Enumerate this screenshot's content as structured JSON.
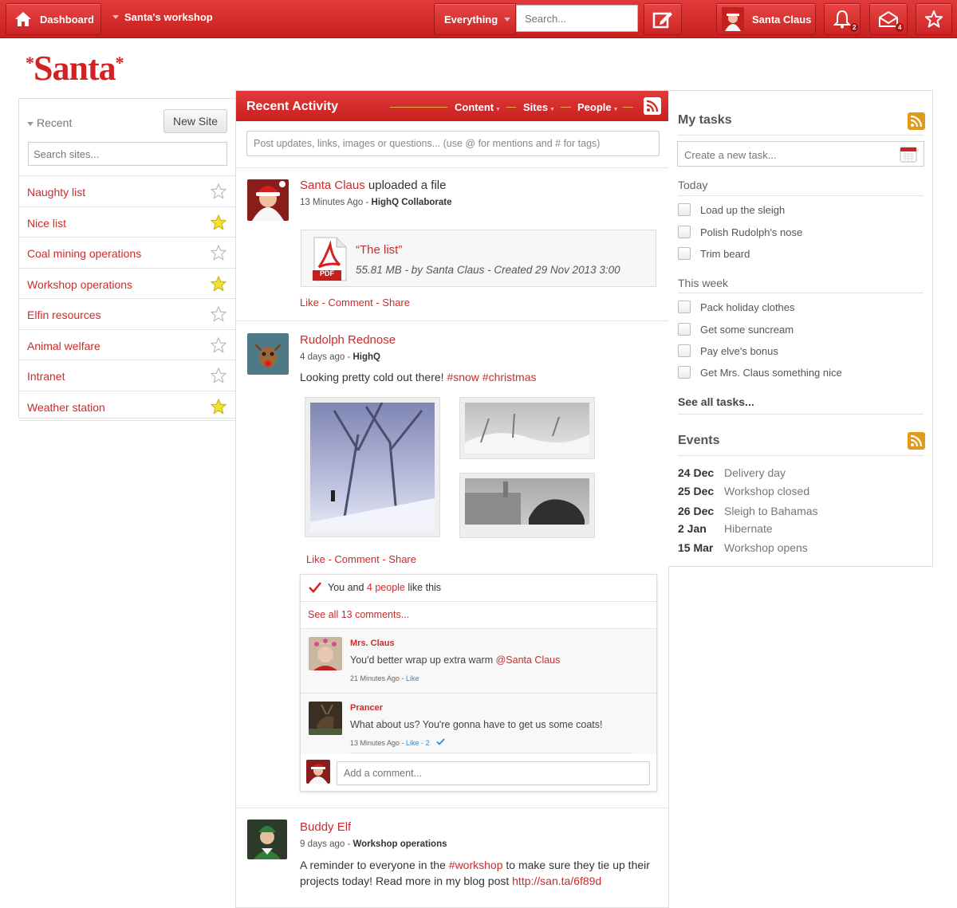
{
  "topbar": {
    "dashboard": "Dashboard",
    "workshop": "Santa's workshop",
    "scope": "Everything",
    "search_placeholder": "Search...",
    "user": "Santa Claus",
    "notifications_count": "2",
    "messages_count": "4"
  },
  "logo": {
    "text": "Santa",
    "mark": "*"
  },
  "sidebar": {
    "recent_label": "Recent",
    "new_site": "New Site",
    "search_placeholder": "Search sites...",
    "items": [
      {
        "label": "Naughty list",
        "starred": false
      },
      {
        "label": "Nice list",
        "starred": true
      },
      {
        "label": "Coal mining operations",
        "starred": false
      },
      {
        "label": "Workshop operations",
        "starred": true
      },
      {
        "label": "Elfin resources",
        "starred": false
      },
      {
        "label": "Animal welfare",
        "starred": false
      },
      {
        "label": "Intranet",
        "starred": false
      },
      {
        "label": "Weather station",
        "starred": true
      }
    ]
  },
  "activity": {
    "title": "Recent Activity",
    "filters": [
      "Content",
      "Sites",
      "People"
    ],
    "post_placeholder": "Post updates, links, images or questions... (use @ for mentions and # for tags)",
    "posts": [
      {
        "author": "Santa Claus",
        "verb": "uploaded a file",
        "time": "13 Minutes Ago",
        "site": "HighQ Collaborate",
        "file_title": "“The list”",
        "file_meta": "55.81 MB - by Santa Claus - Created 29 Nov 2013 3:00",
        "file_badge": "PDF",
        "actions": "Like - Comment - Share"
      },
      {
        "author": "Rudolph Rednose",
        "time": "4 days ago",
        "site": "HighQ",
        "text": "Looking pretty cold out there!",
        "tags": "#snow #christmas",
        "actions": "Like - Comment - Share",
        "likes_prefix": "You and",
        "likes_link": "4 people",
        "likes_suffix": "like this",
        "see_all": "See all 13 comments...",
        "comments": [
          {
            "author": "Mrs. Claus",
            "text": "You'd better wrap up extra warm",
            "mention": "@Santa Claus",
            "time": "21 Minutes Ago",
            "like": "Like"
          },
          {
            "author": "Prancer",
            "text": "What about us? You're gonna have to get us some coats!",
            "time": "13 Minutes Ago",
            "like": "Like - 2"
          }
        ],
        "comment_placeholder": "Add a comment..."
      },
      {
        "author": "Buddy Elf",
        "time": "9 days ago",
        "site": "Workshop operations",
        "text_a": "A reminder to everyone in the",
        "tag": "#workshop",
        "text_b": "to make sure they tie up their",
        "text_c": "projects today! Read more in my blog post",
        "link": "http://san.ta/6f89d"
      }
    ]
  },
  "tasks": {
    "title": "My tasks",
    "placeholder": "Create a new task...",
    "today_label": "Today",
    "today": [
      "Load up the sleigh",
      "Polish Rudolph's nose",
      "Trim beard"
    ],
    "week_label": "This week",
    "week": [
      "Pack holiday clothes",
      "Get some suncream",
      "Pay elve's bonus",
      "Get Mrs. Claus something nice"
    ],
    "see_all": "See all tasks..."
  },
  "events": {
    "title": "Events",
    "items": [
      {
        "date": "24 Dec",
        "name": "Delivery day"
      },
      {
        "date": "25 Dec",
        "name": "Workshop closed"
      },
      {
        "date": "26 Dec",
        "name": "Sleigh to Bahamas"
      },
      {
        "date": "2 Jan",
        "name": "Hibernate"
      },
      {
        "date": "15 Mar",
        "name": "Workshop opens"
      }
    ]
  },
  "colors": {
    "brand": "#cc2b2b",
    "star": "#f2e232",
    "rss": "#e09a1a"
  }
}
